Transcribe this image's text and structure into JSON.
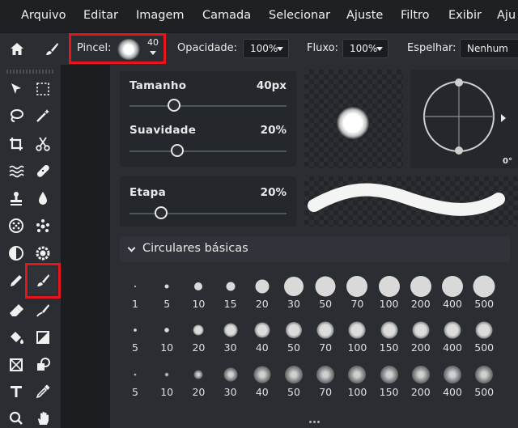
{
  "menu": [
    "Arquivo",
    "Editar",
    "Imagem",
    "Camada",
    "Selecionar",
    "Ajuste",
    "Filtro",
    "Exibir",
    "Aju"
  ],
  "options": {
    "brush_label": "Pincel:",
    "brush_size": "40",
    "opacity_label": "Opacidade:",
    "opacity_value": "100%",
    "flow_label": "Fluxo:",
    "flow_value": "100%",
    "mirror_label": "Espelhar:",
    "mirror_value": "Nenhum"
  },
  "brush_panel": {
    "size_label": "Tamanho",
    "size_value": "40px",
    "size_fraction": 0.18,
    "softness_label": "Suavidade",
    "softness_value": "20%",
    "softness_fraction": 0.2,
    "step_label": "Etapa",
    "step_value": "20%",
    "step_fraction": 0.1,
    "angle_value": "0°",
    "section_title": "Circulares básicas"
  },
  "presets": {
    "row1": [
      "1",
      "5",
      "10",
      "15",
      "20",
      "30",
      "50",
      "70",
      "100",
      "200",
      "400",
      "500"
    ],
    "row2": [
      "5",
      "10",
      "20",
      "30",
      "40",
      "50",
      "70",
      "100",
      "150",
      "200",
      "400",
      "500"
    ],
    "row3": [
      "5",
      "10",
      "20",
      "30",
      "40",
      "50",
      "70",
      "100",
      "150",
      "200",
      "400",
      "500"
    ]
  },
  "tools": [
    "move-tool",
    "marquee-select-tool",
    "lasso-tool",
    "magic-wand-tool",
    "crop-tool",
    "cut-tool",
    "liquify-tool",
    "healing-bandage-tool",
    "stamp-tool",
    "drop-tool",
    "sponge-tool",
    "dots-tool",
    "dodge-tool",
    "settings-tool",
    "pencil-tool",
    "brush-tool",
    "eraser-tool",
    "smudge-tool",
    "fill-tool",
    "gradient-tool",
    "frame-tool",
    "shape-tool",
    "text-tool",
    "eyedropper-tool",
    "zoom-tool",
    "hand-tool"
  ],
  "colors": {
    "highlight": "#e8141c",
    "panel": "#2a2d31"
  }
}
